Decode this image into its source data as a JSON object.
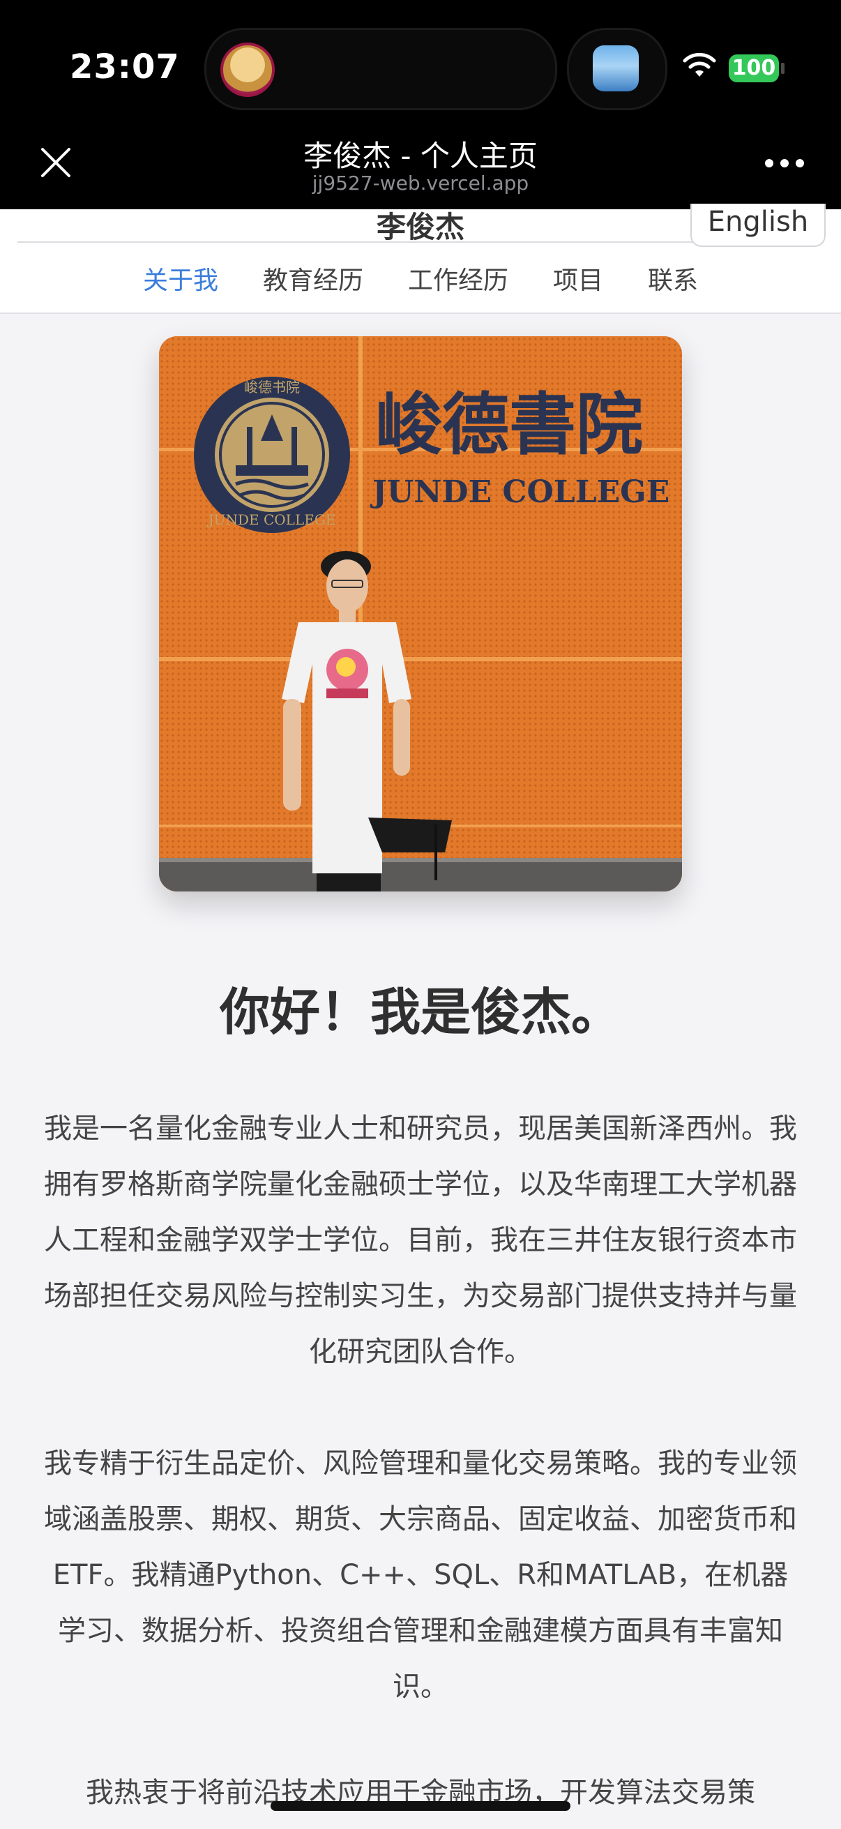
{
  "status_bar": {
    "time": "23:07",
    "battery_level": "100",
    "battery_color": "#34c759",
    "icons": [
      "wifi-icon",
      "battery-icon"
    ]
  },
  "browser": {
    "title": "李俊杰 - 个人主页",
    "url": "jj9527-web.vercel.app",
    "icons": [
      "close-icon",
      "more-icon"
    ]
  },
  "site": {
    "name": "李俊杰",
    "language_button": "English",
    "nav": [
      {
        "label": "关于我",
        "active": true
      },
      {
        "label": "教育经历",
        "active": false
      },
      {
        "label": "工作经历",
        "active": false
      },
      {
        "label": "项目",
        "active": false
      },
      {
        "label": "联系",
        "active": false
      }
    ],
    "accent_color": "#3b7ddd"
  },
  "photo": {
    "sign_text_cn": "峻德書院",
    "sign_text_en": "JUNDE COLLEGE",
    "emblem_top_text": "峻德书院",
    "emblem_ring_text": "JUNDE COLLEGE"
  },
  "about": {
    "greeting": "你好！我是俊杰。",
    "paragraphs": [
      "我是一名量化金融专业人士和研究员，现居美国新泽西州。我拥有罗格斯商学院量化金融硕士学位，以及华南理工大学机器人工程和金融学双学士学位。目前，我在三井住友银行资本市场部担任交易风险与控制实习生，为交易部门提供支持并与量化研究团队合作。",
      "我专精于衍生品定价、风险管理和量化交易策略。我的专业领域涵盖股票、期权、期货、大宗商品、固定收益、加密货币和ETF。我精通Python、C++、SQL、R和MATLAB，在机器学习、数据分析、投资组合管理和金融建模方面具有丰富知识。",
      "我热衷于将前沿技术应用于金融市场，开发算法交易策"
    ]
  }
}
